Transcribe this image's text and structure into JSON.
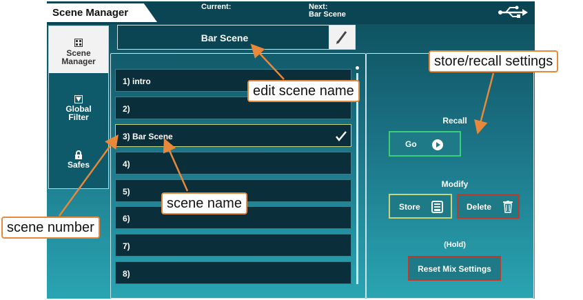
{
  "app": {
    "title": "Scene Manager",
    "current_label": "Current:",
    "current_value": "",
    "next_label": "Next:",
    "next_value": "Bar Scene",
    "usb_icon": "usb-icon"
  },
  "sidebar": {
    "items": [
      {
        "label_line1": "Scene",
        "label_line2": "Manager",
        "icon": "scene-grid-icon",
        "active": true
      },
      {
        "label_line1": "Global",
        "label_line2": "Filter",
        "icon": "filter-icon",
        "active": false
      },
      {
        "label_line1": "Safes",
        "label_line2": "",
        "icon": "lock-icon",
        "active": false
      }
    ]
  },
  "scene_name_field": {
    "value": "Bar Scene",
    "edit_icon": "pencil-icon"
  },
  "scenes": [
    {
      "label": "1) intro"
    },
    {
      "label": "2)"
    },
    {
      "label": "3) Bar Scene",
      "selected": true
    },
    {
      "label": "4)"
    },
    {
      "label": "5)"
    },
    {
      "label": "6)"
    },
    {
      "label": "7)"
    },
    {
      "label": "8)"
    }
  ],
  "controls": {
    "recall_heading": "Recall",
    "go_label": "Go",
    "modify_heading": "Modify",
    "store_label": "Store",
    "delete_label": "Delete",
    "hold_label": "(Hold)",
    "reset_label": "Reset Mix Settings"
  },
  "callouts": {
    "edit_scene_name": "edit scene name",
    "store_recall": "store/recall settings",
    "scene_name": "scene name",
    "scene_number": "scene number"
  },
  "colors": {
    "accent_green": "#3ccf7a",
    "accent_yellow": "#c9d57a",
    "delete_red": "#c0392b",
    "callout_orange": "#e8883a"
  }
}
